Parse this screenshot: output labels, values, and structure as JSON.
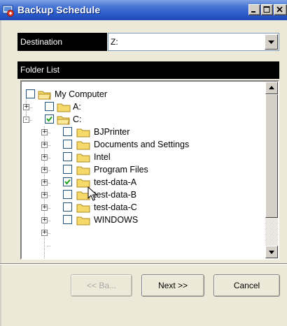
{
  "window": {
    "title": "Backup Schedule",
    "icon": "backup-app-icon"
  },
  "destination": {
    "label": "Destination",
    "value": "Z:"
  },
  "folder_list": {
    "header": "Folder List",
    "tree": [
      {
        "label": "My Computer",
        "checked": false,
        "expander": ""
      },
      {
        "label": "A:",
        "checked": false,
        "expander": "+"
      },
      {
        "label": "C:",
        "checked": true,
        "expander": "-"
      },
      {
        "label": "BJPrinter",
        "checked": false,
        "expander": "+"
      },
      {
        "label": "Documents and Settings",
        "checked": false,
        "expander": "+"
      },
      {
        "label": "Intel",
        "checked": false,
        "expander": "+"
      },
      {
        "label": "Program Files",
        "checked": false,
        "expander": "+"
      },
      {
        "label": "test-data-A",
        "checked": true,
        "expander": "+"
      },
      {
        "label": "test-data-B",
        "checked": false,
        "expander": "+"
      },
      {
        "label": "test-data-C",
        "checked": false,
        "expander": "+"
      },
      {
        "label": "WINDOWS",
        "checked": false,
        "expander": "+"
      }
    ]
  },
  "buttons": {
    "back": "<< Ba...",
    "next": "Next >>",
    "cancel": "Cancel"
  },
  "colors": {
    "titlebar": "#2a5bc8",
    "folder": "#f6d96b",
    "label_bg": "#000000"
  }
}
